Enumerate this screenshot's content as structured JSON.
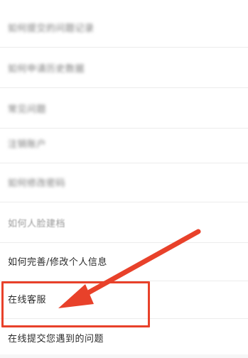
{
  "menu": {
    "items": [
      {
        "label": "如何提交的问题记录"
      },
      {
        "label": "如何申请历史数据"
      },
      {
        "label": "常见问题"
      },
      {
        "label": "注销账户"
      },
      {
        "label": "如何修改密码"
      },
      {
        "label": "如何人脸建档"
      },
      {
        "label": "如何完善/修改个人信息"
      },
      {
        "label": "在线客服"
      },
      {
        "label": "在线提交您遇到的问题"
      }
    ]
  },
  "annotation": {
    "color": "#e8412a"
  }
}
